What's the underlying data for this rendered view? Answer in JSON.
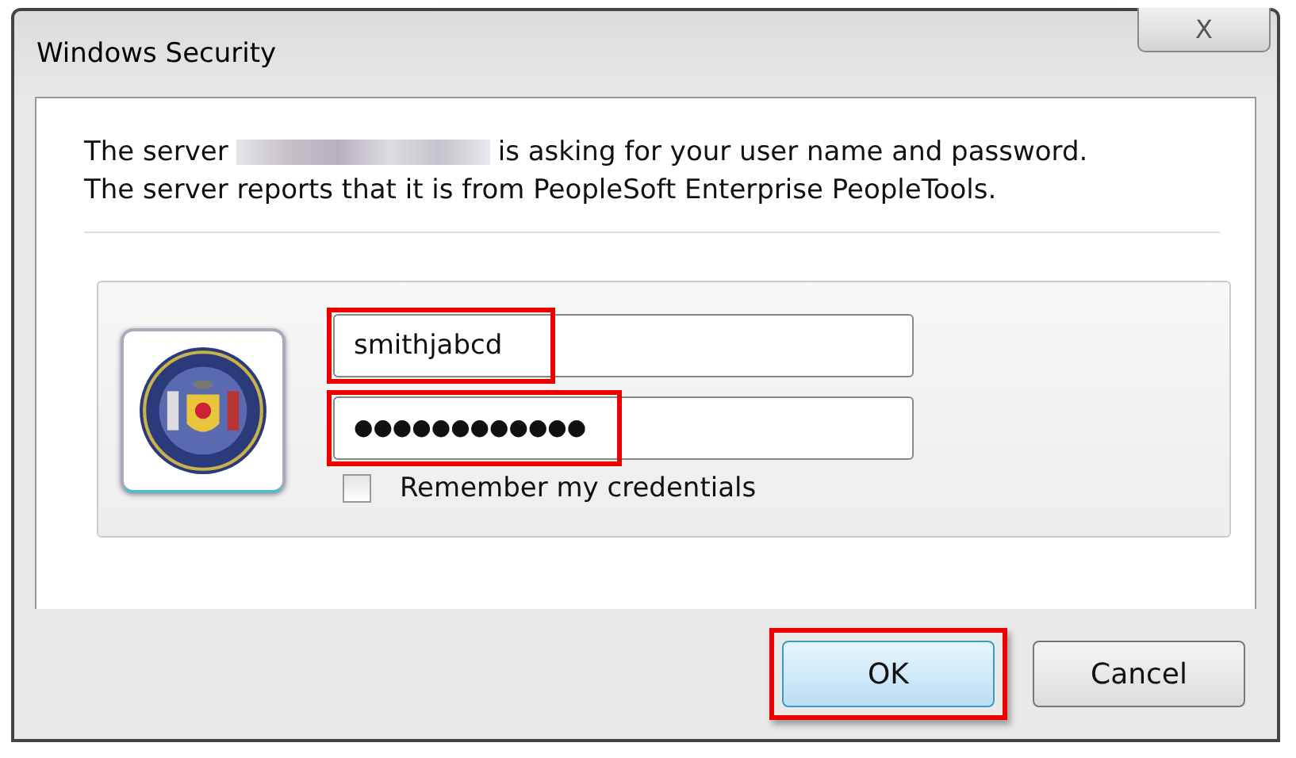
{
  "window": {
    "title": "Windows Security",
    "close_label": "X"
  },
  "message": {
    "line1_before": "The server",
    "line1_after": "is asking for your user name and password.",
    "line2": "The server reports that it is from PeopleSoft Enterprise PeopleTools."
  },
  "credentials": {
    "username": {
      "value": "smithjabcd",
      "highlighted": true
    },
    "password": {
      "value": "●●●●●●●●●●●●",
      "highlighted": true
    },
    "remember": {
      "label": "Remember my credentials",
      "checked": false
    }
  },
  "buttons": [
    {
      "label": "OK",
      "default": true,
      "highlighted": true
    },
    {
      "label": "Cancel",
      "default": false,
      "highlighted": false
    }
  ]
}
